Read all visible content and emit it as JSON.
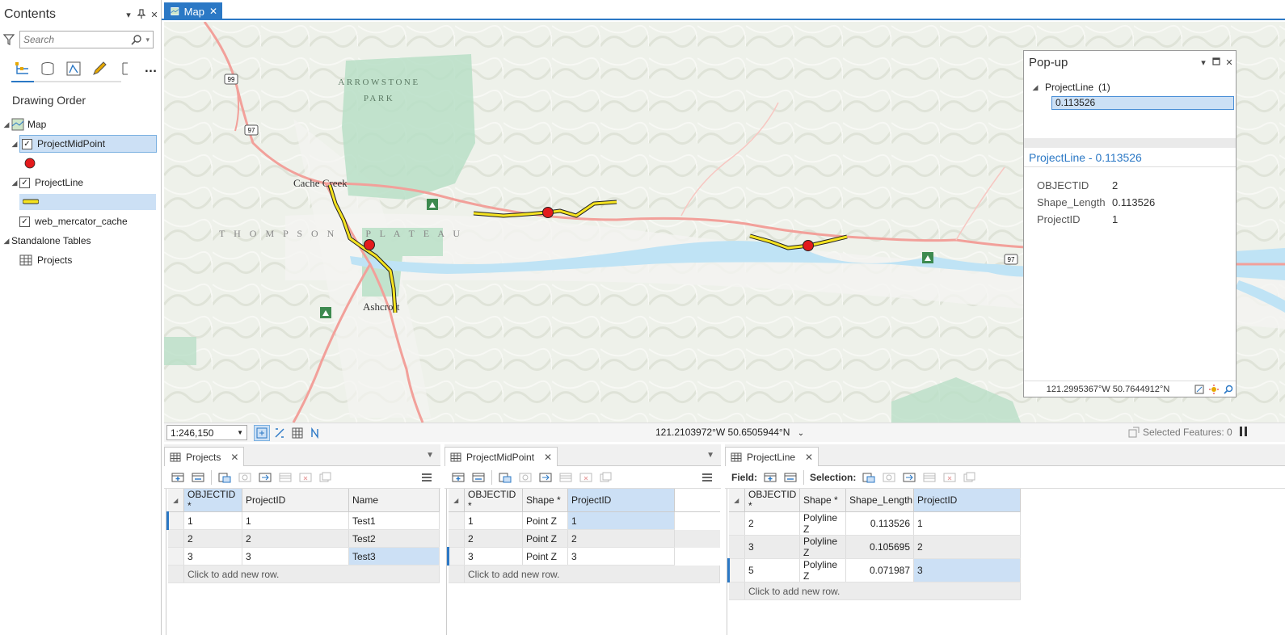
{
  "contents": {
    "title": "Contents",
    "search_placeholder": "Search",
    "drawing_order": "Drawing Order",
    "tree": {
      "map": "Map",
      "layer_midpoint": "ProjectMidPoint",
      "layer_line": "ProjectLine",
      "layer_basemap": "web_mercator_cache",
      "standalone": "Standalone Tables",
      "table_projects": "Projects"
    }
  },
  "map_tab": {
    "label": "Map"
  },
  "map": {
    "labels": {
      "arrowstone": "ARROWSTONE",
      "park": "PARK",
      "cache_creek": "Cache Creek",
      "thompson": "T H O M P S O N     P L A T E A U",
      "ashcroft": "Ashcroft",
      "hwy99": "99",
      "hwy97a": "97",
      "hwy97b": "97"
    },
    "colors": {
      "park": "#b9dfc7",
      "road": "#f2a09a",
      "river": "#bfe3f5",
      "line": "#f5e320",
      "point": "#e31a1c"
    }
  },
  "popup": {
    "title": "Pop-up",
    "layer": "ProjectLine",
    "count": "(1)",
    "feature": "0.113526",
    "header": "ProjectLine - 0.113526",
    "attrs": [
      {
        "k": "OBJECTID",
        "v": "2"
      },
      {
        "k": "Shape_Length",
        "v": "0.113526"
      },
      {
        "k": "ProjectID",
        "v": "1"
      }
    ],
    "coords": "121.2995367°W 50.7644912°N"
  },
  "status": {
    "scale": "1:246,150",
    "coords": "121.2103972°W 50.6505944°N",
    "selected": "Selected Features: 0"
  },
  "tables": {
    "projects": {
      "tab": "Projects",
      "headers": [
        "OBJECTID *",
        "ProjectID",
        "Name"
      ],
      "rows": [
        [
          "1",
          "1",
          "Test1"
        ],
        [
          "2",
          "2",
          "Test2"
        ],
        [
          "3",
          "3",
          "Test3"
        ]
      ],
      "add": "Click to add new row."
    },
    "midpoint": {
      "tab": "ProjectMidPoint",
      "headers": [
        "OBJECTID *",
        "Shape *",
        "ProjectID"
      ],
      "rows": [
        [
          "1",
          "Point Z",
          "1"
        ],
        [
          "2",
          "Point Z",
          "2"
        ],
        [
          "3",
          "Point Z",
          "3"
        ]
      ],
      "add": "Click to add new row."
    },
    "line": {
      "tab": "ProjectLine",
      "field_label": "Field:",
      "selection_label": "Selection:",
      "headers": [
        "OBJECTID *",
        "Shape *",
        "Shape_Length",
        "ProjectID"
      ],
      "rows": [
        [
          "2",
          "Polyline Z",
          "0.113526",
          "1"
        ],
        [
          "3",
          "Polyline Z",
          "0.105695",
          "2"
        ],
        [
          "5",
          "Polyline Z",
          "0.071987",
          "3"
        ]
      ],
      "add": "Click to add new row."
    }
  }
}
